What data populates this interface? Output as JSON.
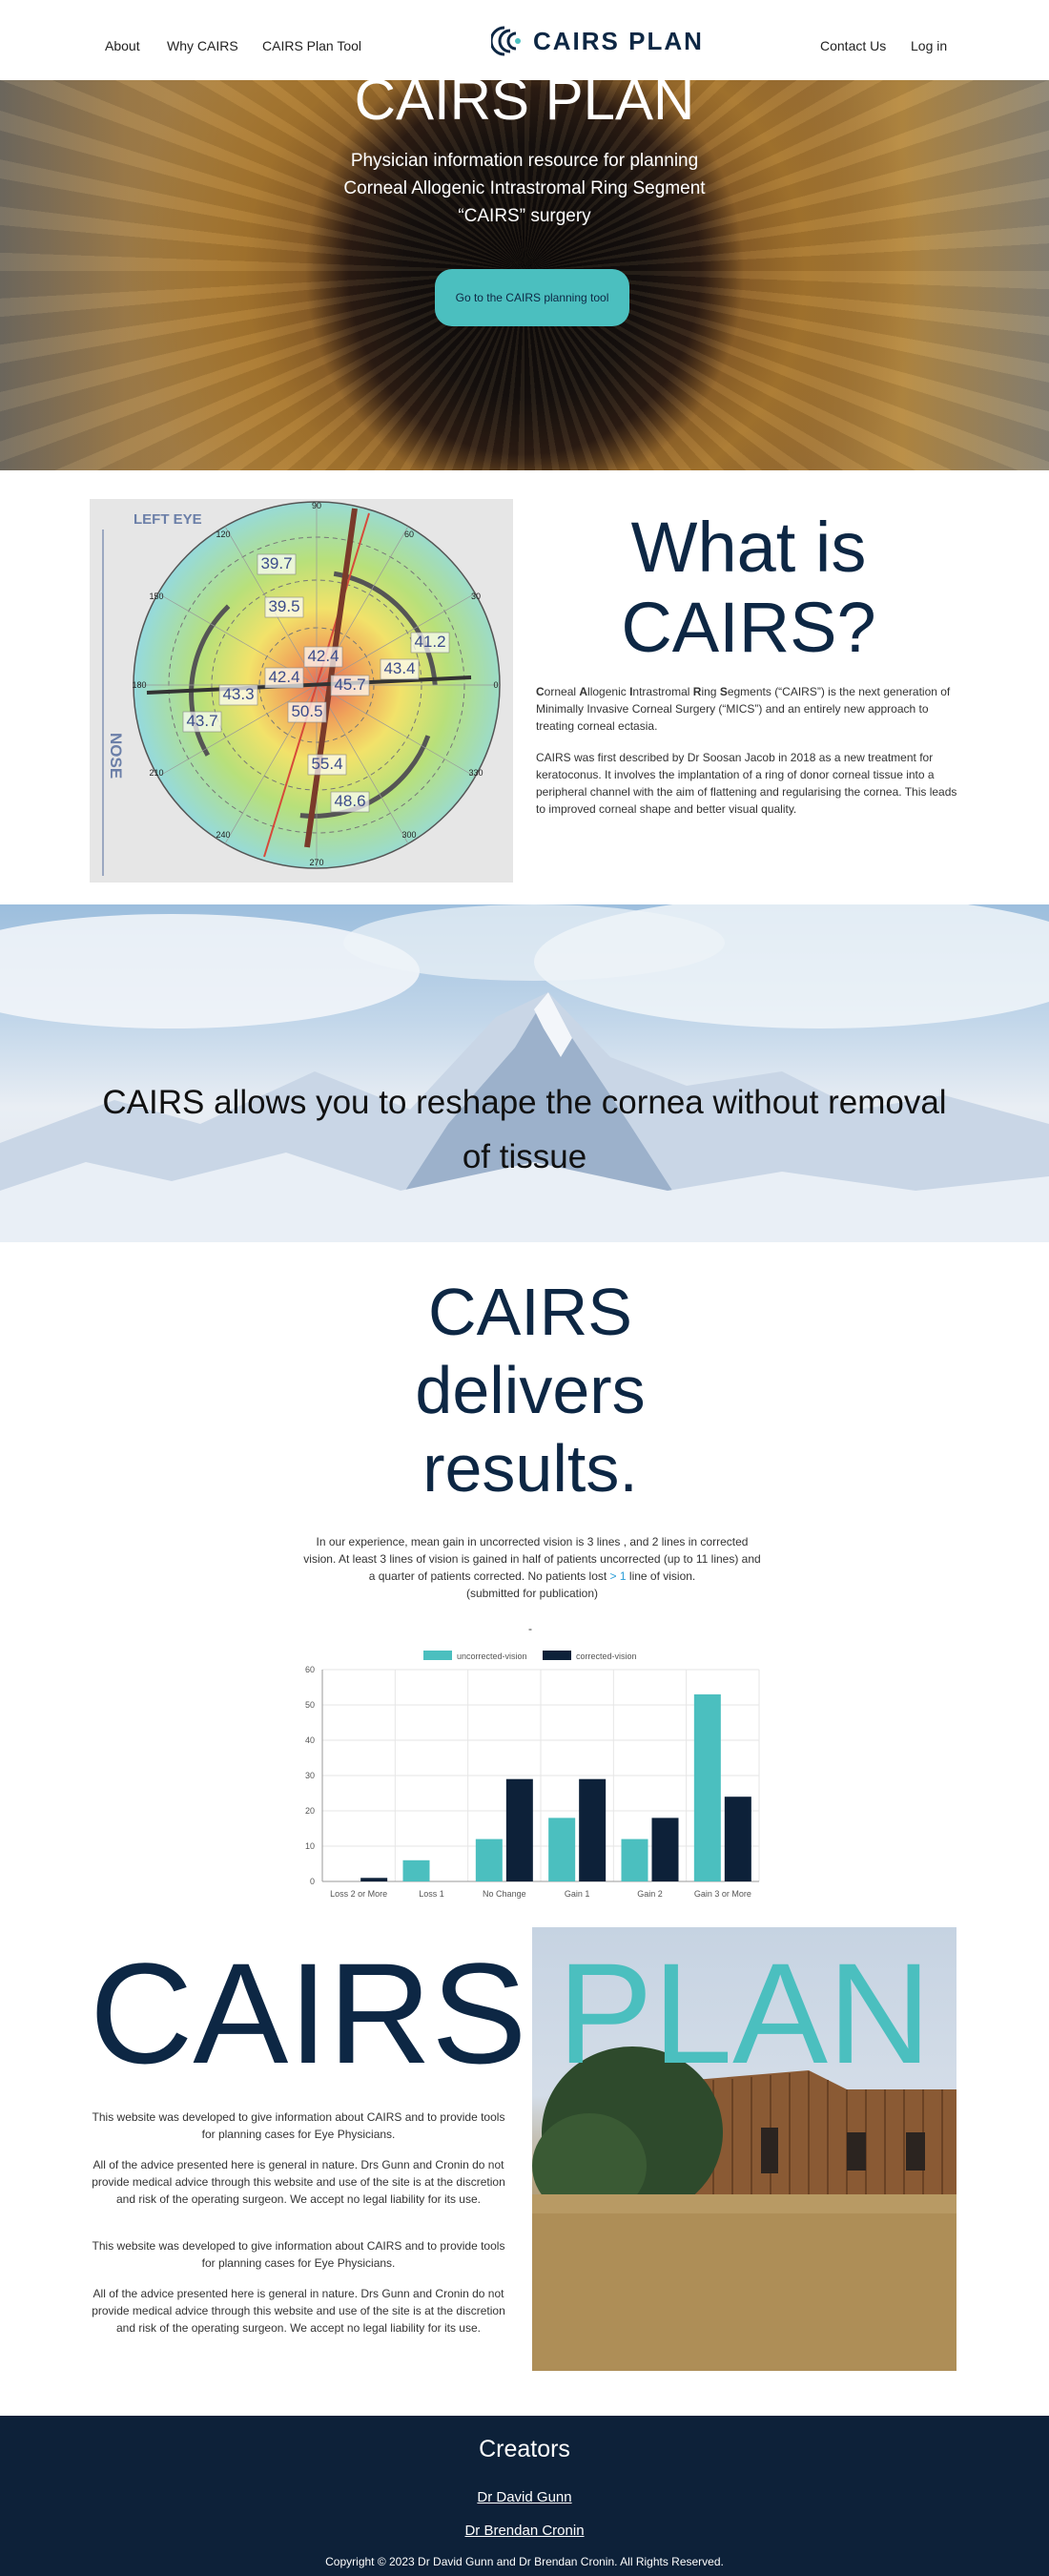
{
  "nav": {
    "left_links": [
      "About",
      "Why CAIRS",
      "CAIRS Plan Tool"
    ],
    "logo_text": "CAIRS PLAN",
    "right_links": [
      "Contact Us",
      "Log in"
    ]
  },
  "hero": {
    "title": "CAIRS PLAN",
    "subtitle": "Physician information resource for planning Corneal Allogenic Intrastromal Ring Segment “CAIRS” surgery",
    "button_label": "Go to the CAIRS planning tool"
  },
  "what": {
    "title": "What is CAIRS?",
    "para1_parts": [
      {
        "bold": "C"
      },
      {
        "text": "orneal "
      },
      {
        "bold": "A"
      },
      {
        "text": "llogenic "
      },
      {
        "bold": "I"
      },
      {
        "text": "ntrastromal "
      },
      {
        "bold": "R"
      },
      {
        "text": "ing "
      },
      {
        "bold": "S"
      },
      {
        "text": "egments (“CAIRS”) is the next generation of Minimally Invasive Corneal Surgery (“MICS”) and an entirely new approach to treating corneal ectasia."
      }
    ],
    "para2": "CAIRS was first described by Dr Soosan Jacob in 2018 as a new treatment for keratoconus. It involves the implantation of a ring of donor corneal tissue into a peripheral channel with the aim of flattening and regularising the cornea. This leads to improved corneal shape and better visual quality."
  },
  "topography": {
    "eye_label": "LEFT EYE",
    "side_label": "NOSE",
    "angle_labels": [
      "90",
      "60",
      "30",
      "0",
      "330",
      "300",
      "270",
      "240",
      "210",
      "180",
      "150",
      "120"
    ],
    "values": [
      "39.7",
      "39.5",
      "42.4",
      "41.2",
      "43.4",
      "42.4",
      "45.7",
      "43.3",
      "43.7",
      "50.5",
      "55.4",
      "48.6"
    ],
    "colors": {
      "cyan": "#8fd9ef",
      "green": "#b8e07a",
      "yellow": "#f2e26a",
      "orange": "#f0a45a",
      "red": "#e2665a",
      "ring": "#7a3a2a",
      "axis": "#d64a3a"
    }
  },
  "mountain": {
    "text": "CAIRS allows you to reshape the cornea without removal of tissue"
  },
  "delivers": {
    "title": "CAIRS delivers results.",
    "para_before": "In our experience, mean gain in uncorrected vision is 3 lines , and 2 lines in corrected vision. At least 3 lines of vision is gained in half of patients uncorrected (up to 11 lines) and a quarter of patients corrected. No patients lost ",
    "para_highlight": "> 1",
    "para_after": " line of vision.",
    "para_note": "(submitted for publication)",
    "dash": "-"
  },
  "chart_data": {
    "type": "bar",
    "categories": [
      "Loss 2 or More",
      "Loss 1",
      "No Change",
      "Gain 1",
      "Gain 2",
      "Gain 3 or More"
    ],
    "series": [
      {
        "name": "uncorrected-vision",
        "color": "#4bbfbf",
        "values": [
          0,
          6,
          12,
          18,
          12,
          53
        ]
      },
      {
        "name": "corrected-vision",
        "color": "#0d2139",
        "values": [
          1,
          0,
          29,
          29,
          18,
          24
        ]
      }
    ],
    "y_ticks": [
      "0",
      "10",
      "20",
      "30",
      "40",
      "50",
      "60"
    ],
    "ylim": [
      0,
      60
    ],
    "grid": true,
    "legend": "top"
  },
  "plan": {
    "big_left": "CAIRS",
    "big_right": "PLAN",
    "paragraphs": [
      "This website was developed to give information about CAIRS and to provide tools for planning cases for Eye Physicians.",
      "All of the advice presented here is general in nature. Drs Gunn and Cronin do not provide medical advice through this website and use of the site is at the discretion and risk of the operating surgeon. We accept no legal liability for its use.",
      "This website was developed to give information about CAIRS and to provide tools for planning cases for Eye Physicians.",
      "All of the advice presented here is general in nature. Drs Gunn and Cronin do not provide medical advice through this website and use of the site is at the discretion and risk of the operating surgeon. We accept no legal liability for its use."
    ]
  },
  "footer": {
    "title": "Creators",
    "creators": [
      "Dr David Gunn",
      "Dr Brendan Cronin"
    ],
    "copyright": "Copyright © 2023 Dr David Gunn and Dr Brendan Cronin. All Rights Reserved."
  }
}
